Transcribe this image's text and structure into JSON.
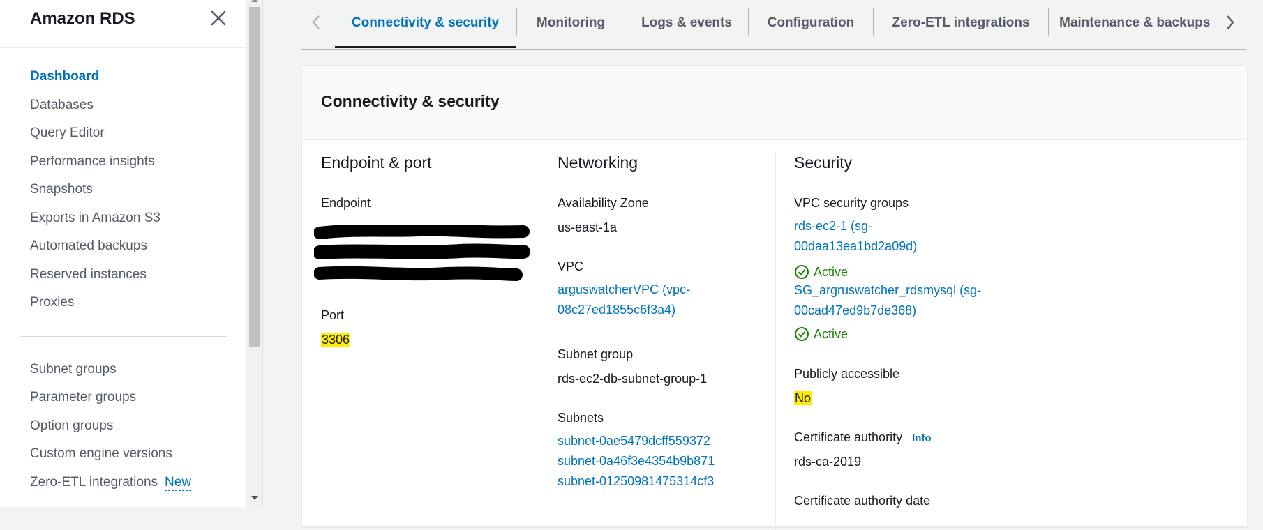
{
  "sidebar": {
    "title": "Amazon RDS",
    "items": [
      {
        "label": "Dashboard"
      },
      {
        "label": "Databases"
      },
      {
        "label": "Query Editor"
      },
      {
        "label": "Performance insights"
      },
      {
        "label": "Snapshots"
      },
      {
        "label": "Exports in Amazon S3"
      },
      {
        "label": "Automated backups"
      },
      {
        "label": "Reserved instances"
      },
      {
        "label": "Proxies"
      }
    ],
    "items2": [
      {
        "label": "Subnet groups"
      },
      {
        "label": "Parameter groups"
      },
      {
        "label": "Option groups"
      },
      {
        "label": "Custom engine versions"
      },
      {
        "label": "Zero-ETL integrations",
        "badge": "New"
      }
    ]
  },
  "tabs": [
    {
      "label": "Connectivity & security",
      "active": true
    },
    {
      "label": "Monitoring"
    },
    {
      "label": "Logs & events"
    },
    {
      "label": "Configuration"
    },
    {
      "label": "Zero-ETL integrations"
    },
    {
      "label": "Maintenance & backups"
    }
  ],
  "panel": {
    "title": "Connectivity & security",
    "endpoint": {
      "heading": "Endpoint & port",
      "endpoint_label": "Endpoint",
      "port_label": "Port",
      "port_value": "3306"
    },
    "networking": {
      "heading": "Networking",
      "az_label": "Availability Zone",
      "az_value": "us-east-1a",
      "vpc_label": "VPC",
      "vpc_line1": "arguswatcherVPC (vpc-",
      "vpc_line2": "08c27ed1855c6f3a4)",
      "subnet_group_label": "Subnet group",
      "subnet_group_value": "rds-ec2-db-subnet-group-1",
      "subnets_label": "Subnets",
      "subnets": [
        "subnet-0ae5479dcff559372",
        "subnet-0a46f3e4354b9b871",
        "subnet-01250981475314cf3"
      ]
    },
    "security": {
      "heading": "Security",
      "sg_label": "VPC security groups",
      "sg1_line1": "rds-ec2-1 (sg-",
      "sg1_line2": "00daa13ea1bd2a09d)",
      "sg1_status": "Active",
      "sg2_line1": "SG_argruswatcher_rdsmysql (sg-",
      "sg2_line2": "00cad47ed9b7de368)",
      "sg2_status": "Active",
      "public_label": "Publicly accessible",
      "public_value": "No",
      "ca_label": "Certificate authority",
      "ca_info": "Info",
      "ca_value": "rds-ca-2019",
      "ca_date_label": "Certificate authority date"
    }
  },
  "colors": {
    "accent": "#0073bb",
    "active_status": "#1d8102",
    "highlight": "#ffec00"
  }
}
